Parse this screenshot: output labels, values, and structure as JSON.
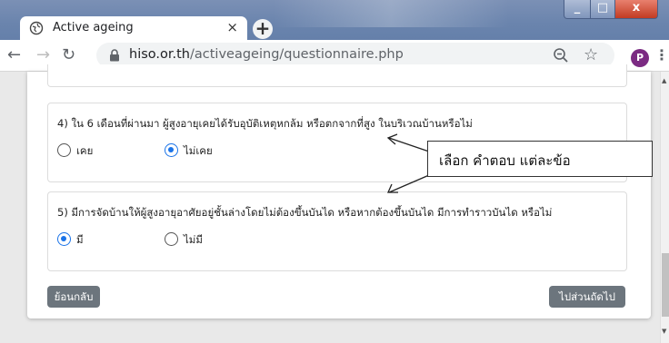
{
  "browser": {
    "tab_title": "Active ageing",
    "tab_close": "×",
    "new_tab": "+",
    "url_domain": "hiso.or.th",
    "url_path": "/activeageing/questionnaire.php",
    "profile_initial": "P",
    "window_min": "_",
    "window_max": "□",
    "window_close": "x"
  },
  "questions": [
    {
      "text": "4) ใน 6 เดือนที่ผ่านมา ผู้สูงอายุเคยได้รับอุบัติเหตุหกล้ม หรือตกจากที่สูง ในบริเวณบ้านหรือไม่",
      "options": [
        {
          "label": "เคย",
          "checked": false
        },
        {
          "label": "ไม่เคย",
          "checked": true
        }
      ]
    },
    {
      "text": "5) มีการจัดบ้านให้ผู้สูงอายุอาศัยอยู่ชั้นล่างโดยไม่ต้องขึ้นบันได หรือหากต้องขึ้นบันได มีการทำราวบันได หรือไม่",
      "options": [
        {
          "label": "มี",
          "checked": true
        },
        {
          "label": "ไม่มี",
          "checked": false
        }
      ]
    }
  ],
  "buttons": {
    "back_label": "ย้อนกลับ",
    "next_label": "ไปส่วนถัดไป"
  },
  "annotation": {
    "text": "เลือก คำตอบ แต่ละข้อ"
  },
  "colors": {
    "accent": "#1a73e8",
    "button": "#6c757d",
    "profile": "#7b2a82"
  }
}
